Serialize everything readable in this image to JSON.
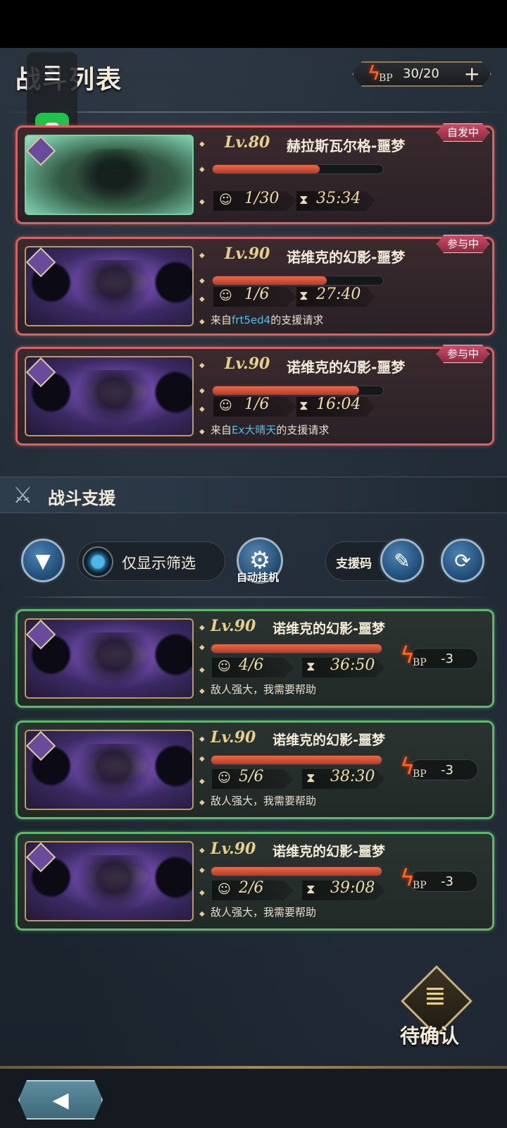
{
  "header": {
    "title": "战斗列表",
    "bp": "30/20",
    "bp_label": "BP",
    "plus": "+"
  },
  "overlay": {
    "menu_glyph": "☰"
  },
  "my_battles": [
    {
      "level": "Lv.80",
      "name": "赫拉斯瓦尔格-噩梦",
      "badge": "自发中",
      "hp_fraction": 0.63,
      "players": "1/30",
      "time": "35:34",
      "request_prefix": "",
      "request_user": "",
      "request_suffix": "",
      "thumb": "owl"
    },
    {
      "level": "Lv.90",
      "name": "诺维克的幻影-噩梦",
      "badge": "参与中",
      "hp_fraction": 0.67,
      "players": "1/6",
      "time": "27:40",
      "request_prefix": "来自",
      "request_user": "frt5ed4",
      "request_suffix": "的支援请求",
      "thumb": "phantom"
    },
    {
      "level": "Lv.90",
      "name": "诺维克的幻影-噩梦",
      "badge": "参与中",
      "hp_fraction": 0.86,
      "players": "1/6",
      "time": "16:04",
      "request_prefix": "来自",
      "request_user": "Ex大晴天",
      "request_suffix": "的支援请求",
      "thumb": "phantom"
    }
  ],
  "support_section": {
    "title": "战斗支援",
    "filter_toggle_label": "仅显示筛选",
    "auto_label": "自动挂机",
    "code_label": "支援码"
  },
  "support_battles": [
    {
      "level": "Lv.90",
      "name": "诺维克的幻影-噩梦",
      "hp_fraction": 1.0,
      "players": "4/6",
      "time": "36:50",
      "message": "敌人强大，我需要帮助",
      "bp_cost": "-3"
    },
    {
      "level": "Lv.90",
      "name": "诺维克的幻影-噩梦",
      "hp_fraction": 1.0,
      "players": "5/6",
      "time": "38:30",
      "message": "敌人强大，我需要帮助",
      "bp_cost": "-3"
    },
    {
      "level": "Lv.90",
      "name": "诺维克的幻影-噩梦",
      "hp_fraction": 1.0,
      "players": "2/6",
      "time": "39:08",
      "message": "敌人强大，我需要帮助",
      "bp_cost": "-3"
    }
  ],
  "footer": {
    "pending_label": "待确认",
    "back_glyph": "◀"
  },
  "colors": {
    "accent_red": "#d66262",
    "accent_green": "#5db86a",
    "gold": "#e4cf8e",
    "link_blue": "#4fc0e8"
  }
}
